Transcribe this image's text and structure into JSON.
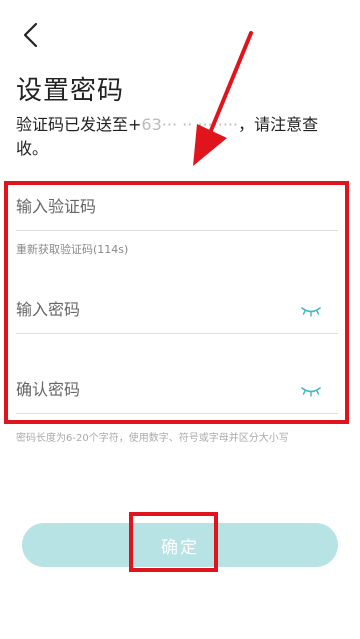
{
  "header": {
    "back_icon": "chevron-left-icon",
    "title": "设置密码"
  },
  "hint": {
    "prefix": "验证码已发送至+",
    "masked_number": "63··· ·· ········",
    "suffix": "，请注意查收。"
  },
  "form": {
    "code_placeholder": "输入验证码",
    "resend_label": "重新获取验证码(114s)",
    "password_placeholder": "输入密码",
    "confirm_placeholder": "确认密码",
    "eye_icon": "eye-closed-icon",
    "rule_text": "密码长度为6-20个字符，使用数字、符号或字母并区分大小写"
  },
  "action": {
    "confirm_label": "确定"
  },
  "colors": {
    "annotation": "#e0141d",
    "button_bg": "#b8e3e4",
    "eye": "#3fb6c8"
  }
}
